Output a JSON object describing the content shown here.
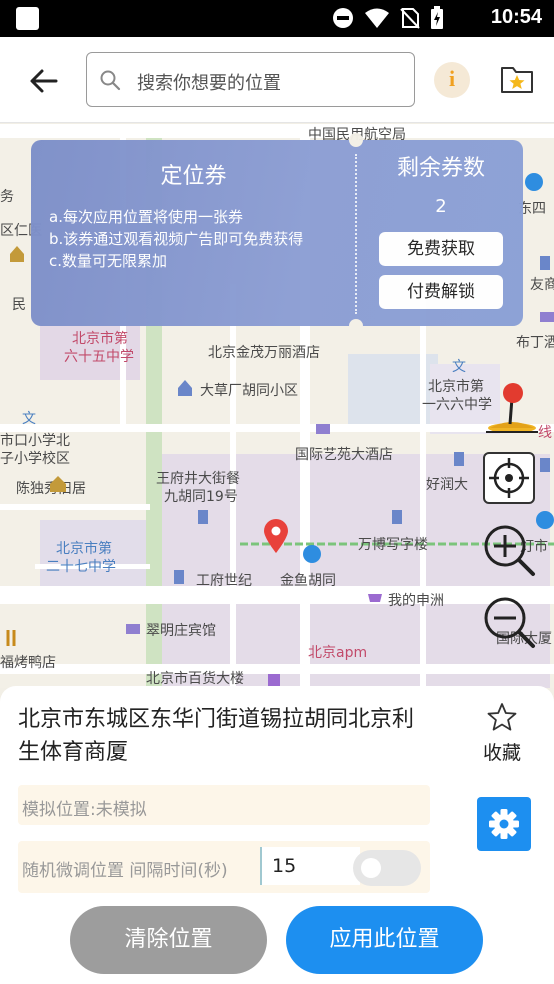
{
  "status_bar": {
    "time": "10:54",
    "icons": [
      "app-icon",
      "do-not-disturb-icon",
      "wifi-icon",
      "no-sim-icon",
      "battery-charging-icon"
    ]
  },
  "top_bar": {
    "search_placeholder": "搜索你想要的位置",
    "info_glyph": "i"
  },
  "map": {
    "labels": [
      "中国民用航空局",
      "务",
      "区仁医",
      "民",
      "北京市第",
      "六十五中学",
      "北京金茂万丽酒店",
      "文",
      "大草厂胡同小区",
      "北京市第",
      "一六六中学",
      "文",
      "市口小学北",
      "子小学校区",
      "国际艺苑大酒店",
      "王府井大街餐",
      "九胡同19号",
      "好润大",
      "陈独秀旧居",
      "北京市第",
      "二十七中学",
      "万博写字楼",
      "工府世纪",
      "金鱼胡同",
      "我的申洲",
      "翠明庄宾馆",
      "北京apm",
      "福烤鸭店",
      "北京市百货大楼",
      "国际大厦",
      "灯市",
      "东四",
      "友商",
      "布丁酒",
      "线"
    ]
  },
  "coupon": {
    "title": "定位券",
    "rules": [
      "a.每次应用位置将使用一张券",
      "b.该券通过观看视频广告即可免费获得",
      "c.数量可无限累加"
    ],
    "remaining_title": "剩余券数",
    "remaining_count": "2",
    "free_get_label": "免费获取",
    "paid_unlock_label": "付费解锁"
  },
  "panel": {
    "address": "北京市东城区东华门街道锡拉胡同北京利生体育商厦",
    "favorite_label": "收藏",
    "simulation_status": "模拟位置:未模拟",
    "random_label": "随机微调位置 间隔时间(秒)",
    "interval_value": "15",
    "random_toggle": "off",
    "clear_label": "清除位置",
    "apply_label": "应用此位置"
  },
  "colors": {
    "accent": "#1d8ff0",
    "coupon": "#8a9bd2",
    "clear_button": "#9d9d9d",
    "marker": "#e8413b"
  }
}
